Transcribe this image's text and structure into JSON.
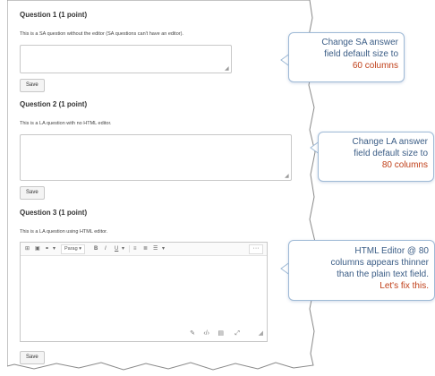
{
  "questions": [
    {
      "title": "Question 1 (1 point)",
      "text": "This is a SA question without the editor (SA questions can't have an editor).",
      "save_label": "Save"
    },
    {
      "title": "Question 2 (1 point)",
      "text": "This is a LA question with no HTML editor.",
      "save_label": "Save"
    },
    {
      "title": "Question 3 (1 point)",
      "text": "This is a LA question using HTML editor.",
      "save_label": "Save",
      "editor": {
        "format_select": "Parag",
        "toolbar_icons": [
          "insert-stuff-icon",
          "insert-image-icon",
          "link-icon",
          "format-select",
          "bold-icon",
          "italic-icon",
          "underline-icon",
          "align-icon",
          "list-icon",
          "more-icon"
        ],
        "bold": "B",
        "italic": "I",
        "underline": "U",
        "more": "···"
      }
    }
  ],
  "callouts": [
    {
      "line1": "Change SA answer",
      "line2": "field default size to",
      "line3": "60 columns"
    },
    {
      "line1": "Change LA answer",
      "line2": "field default size to",
      "line3": "80 columns"
    },
    {
      "line1": "HTML Editor @ 80",
      "line2": "columns appears thinner",
      "line3": "than the plain text field.",
      "line4": "Let's fix this."
    }
  ],
  "colors": {
    "callout_text": "#3b5d86",
    "callout_highlight": "#c0401a",
    "callout_border": "#9fbad6"
  }
}
